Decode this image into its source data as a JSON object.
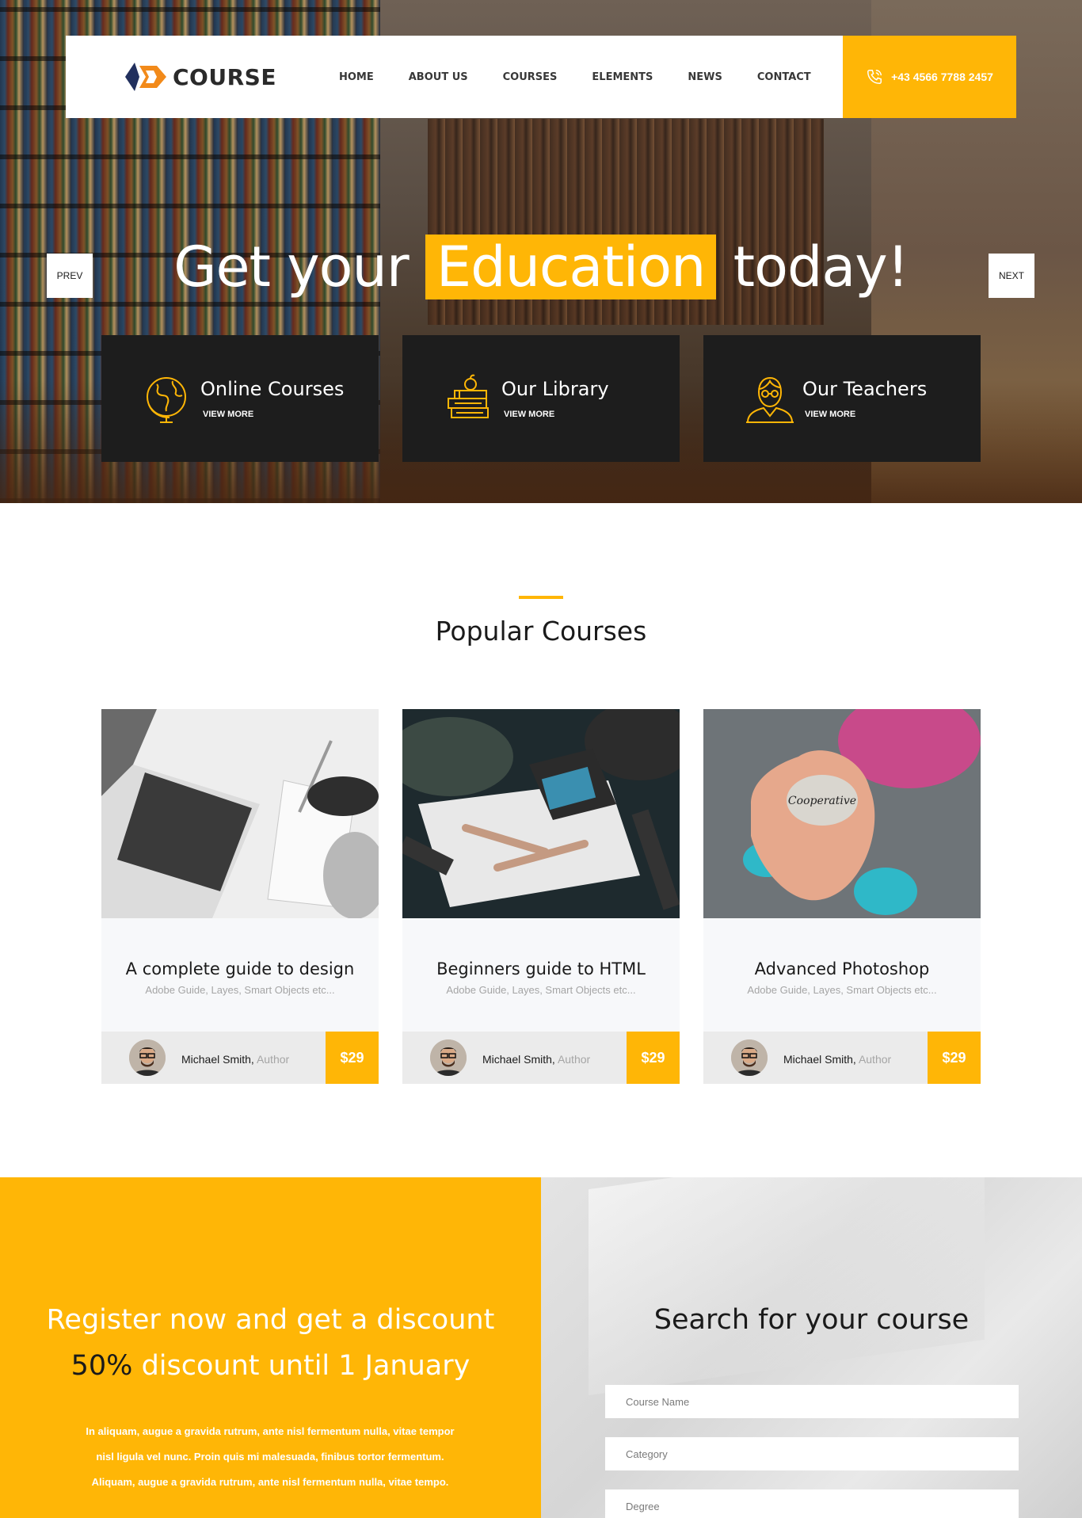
{
  "brand": {
    "name": "COURSE",
    "accent": "#ffb606",
    "dark": "#1d1d1d"
  },
  "nav": {
    "items": [
      "HOME",
      "ABOUT US",
      "COURSES",
      "ELEMENTS",
      "NEWS",
      "CONTACT"
    ],
    "phone": "+43 4566 7788 2457",
    "phone_icon": "phone-icon"
  },
  "hero": {
    "title_before": "Get your",
    "title_highlight": "Education",
    "title_after": "today!",
    "prev_label": "PREV",
    "next_label": "NEXT"
  },
  "features": [
    {
      "title": "Online Courses",
      "link": "VIEW MORE",
      "icon": "globe-icon"
    },
    {
      "title": "Our Library",
      "link": "VIEW MORE",
      "icon": "books-icon"
    },
    {
      "title": "Our Teachers",
      "link": "VIEW MORE",
      "icon": "teacher-icon"
    }
  ],
  "popular": {
    "title": "Popular Courses",
    "courses": [
      {
        "title": "A complete guide to design",
        "subtitle": "Adobe Guide, Layes, Smart Objects etc...",
        "author": "Michael Smith,",
        "role": "Author",
        "price": "$29"
      },
      {
        "title": "Beginners guide to HTML",
        "subtitle": "Adobe Guide, Layes, Smart Objects etc...",
        "author": "Michael Smith,",
        "role": "Author",
        "price": "$29"
      },
      {
        "title": "Advanced Photoshop",
        "subtitle": "Adobe Guide, Layes, Smart Objects etc...",
        "author": "Michael Smith,",
        "role": "Author",
        "price": "$29"
      }
    ]
  },
  "register": {
    "title": "Register now and get a discount",
    "percent": "50%",
    "subtitle_rest": "discount until 1 January",
    "text_lines": [
      "In aliquam, augue a gravida rutrum, ante nisl fermentum nulla, vitae tempor",
      "nisl ligula vel nunc. Proin quis mi malesuada, finibus tortor fermentum.",
      "Aliquam, augue a gravida rutrum, ante nisl fermentum nulla, vitae tempo."
    ]
  },
  "search": {
    "title": "Search for your course",
    "course_name_placeholder": "Course Name",
    "category_placeholder": "Category",
    "degree_placeholder": "Degree"
  }
}
